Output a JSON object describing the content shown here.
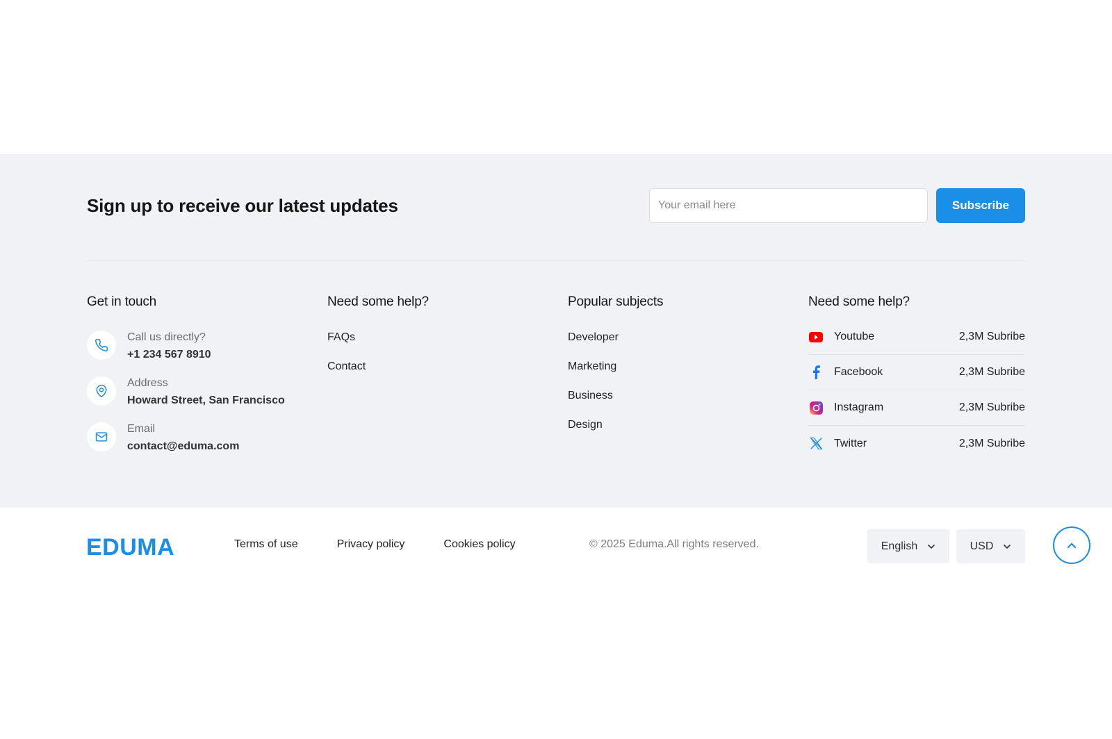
{
  "newsletter": {
    "heading": "Sign up to receive our latest updates",
    "email_placeholder": "Your email here",
    "subscribe_label": "Subscribe"
  },
  "contact": {
    "heading": "Get in touch",
    "items": [
      {
        "label": "Call us directly?",
        "value": "+1 234 567 8910",
        "icon": "phone-icon"
      },
      {
        "label": "Address",
        "value": "Howard Street, San Francisco",
        "icon": "location-pin-icon"
      },
      {
        "label": "Email",
        "value": "contact@eduma.com",
        "icon": "mail-icon"
      }
    ]
  },
  "help": {
    "heading": "Need some help?",
    "links": [
      "FAQs",
      "Contact"
    ]
  },
  "subjects": {
    "heading": "Popular subjects",
    "links": [
      "Developer",
      "Marketing",
      "Business",
      "Design"
    ]
  },
  "social": {
    "heading": "Need some help?",
    "items": [
      {
        "name": "Youtube",
        "count": "2,3M Subribe",
        "icon": "youtube-icon"
      },
      {
        "name": "Facebook",
        "count": "2,3M Subribe",
        "icon": "facebook-icon"
      },
      {
        "name": "Instagram",
        "count": "2,3M Subribe",
        "icon": "instagram-icon"
      },
      {
        "name": "Twitter",
        "count": "2,3M Subribe",
        "icon": "twitter-x-icon"
      }
    ]
  },
  "bottom": {
    "logo": "EDUMA",
    "links": [
      "Terms of use",
      "Privacy policy",
      "Cookies policy"
    ],
    "copyright": "© 2025 Eduma.All rights reserved.",
    "language": "English",
    "currency": "USD"
  },
  "colors": {
    "accent": "#1b8ee8",
    "footer_bg": "#f1f2f6"
  }
}
